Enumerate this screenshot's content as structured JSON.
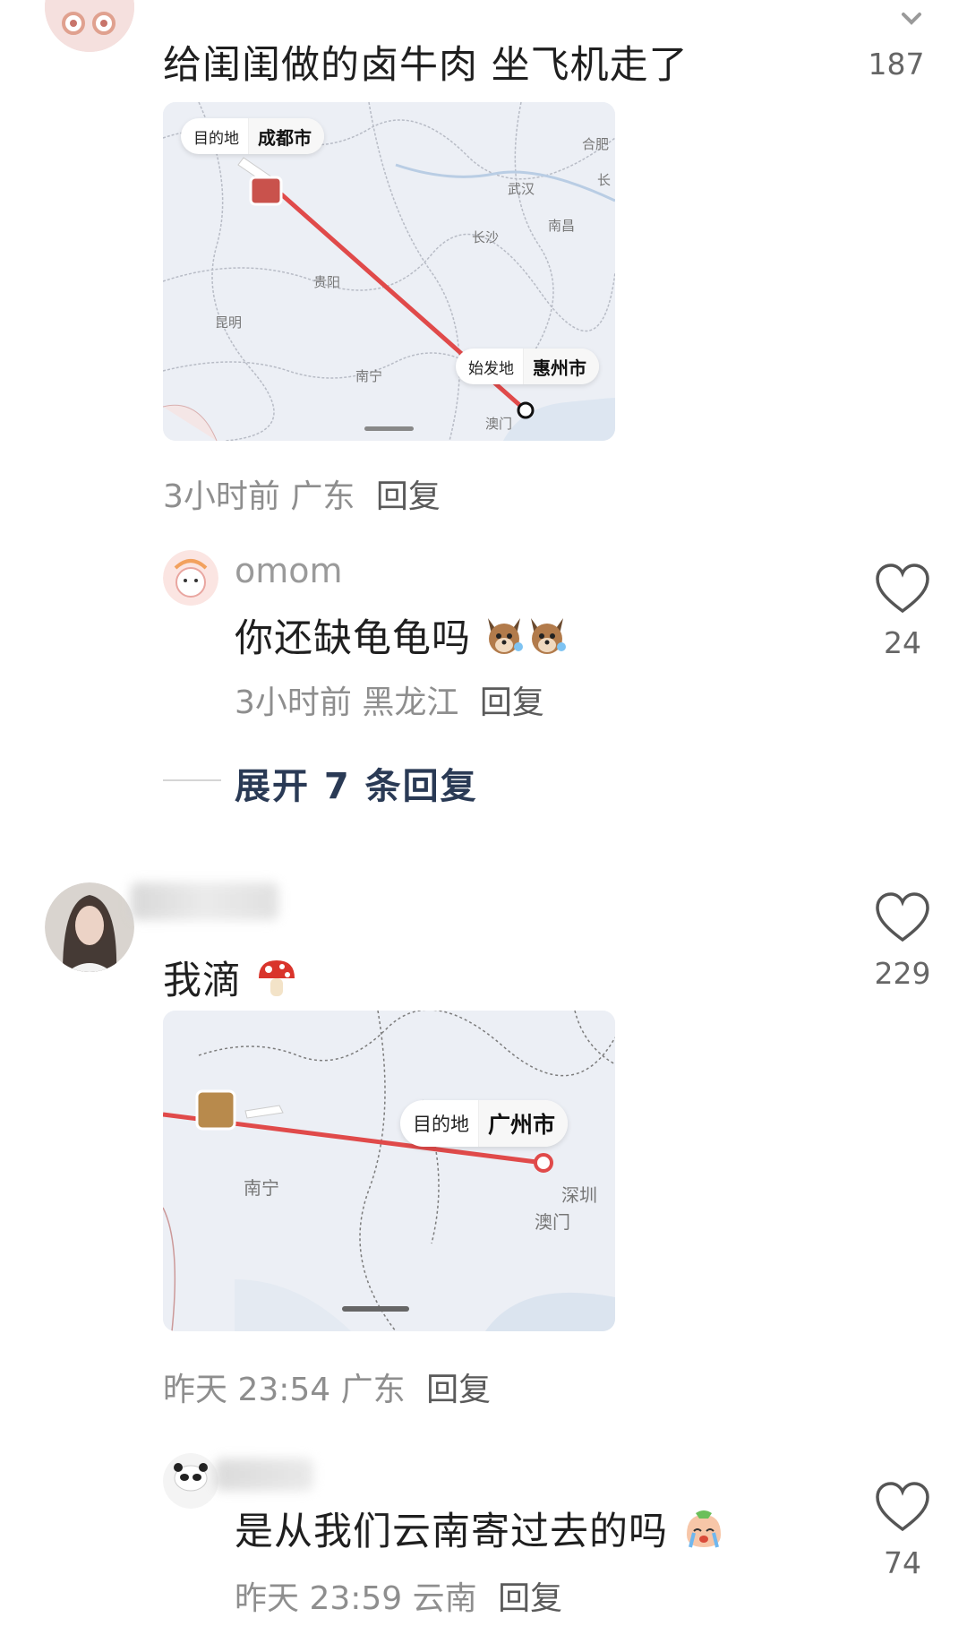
{
  "comments": [
    {
      "text": "给闺闺做的卤牛肉 坐飞机走了",
      "likes": "187",
      "map": {
        "dest_label": "目的地",
        "dest_city": "成都市",
        "origin_label": "始发地",
        "origin_city": "惠州市",
        "cities": [
          "合肥",
          "武汉",
          "长沙",
          "南昌",
          "贵阳",
          "昆明",
          "南宁",
          "澳门",
          "长"
        ]
      },
      "time": "3小时前",
      "location": "广东",
      "reply_label": "回复"
    },
    {
      "username": "omom",
      "text": "你还缺龟龟吗",
      "likes": "24",
      "time": "3小时前",
      "location": "黑龙江",
      "reply_label": "回复"
    },
    {
      "expand_label": "展开 7 条回复"
    },
    {
      "text": "我滴",
      "likes": "229",
      "map": {
        "dest_label": "目的地",
        "dest_city": "广州市",
        "cities": [
          "南宁",
          "深圳",
          "澳门"
        ]
      },
      "time": "昨天 23:54",
      "location": "广东",
      "reply_label": "回复"
    },
    {
      "text": "是从我们云南寄过去的吗",
      "likes": "74",
      "time": "昨天 23:59",
      "location": "云南",
      "reply_label": "回复"
    }
  ]
}
